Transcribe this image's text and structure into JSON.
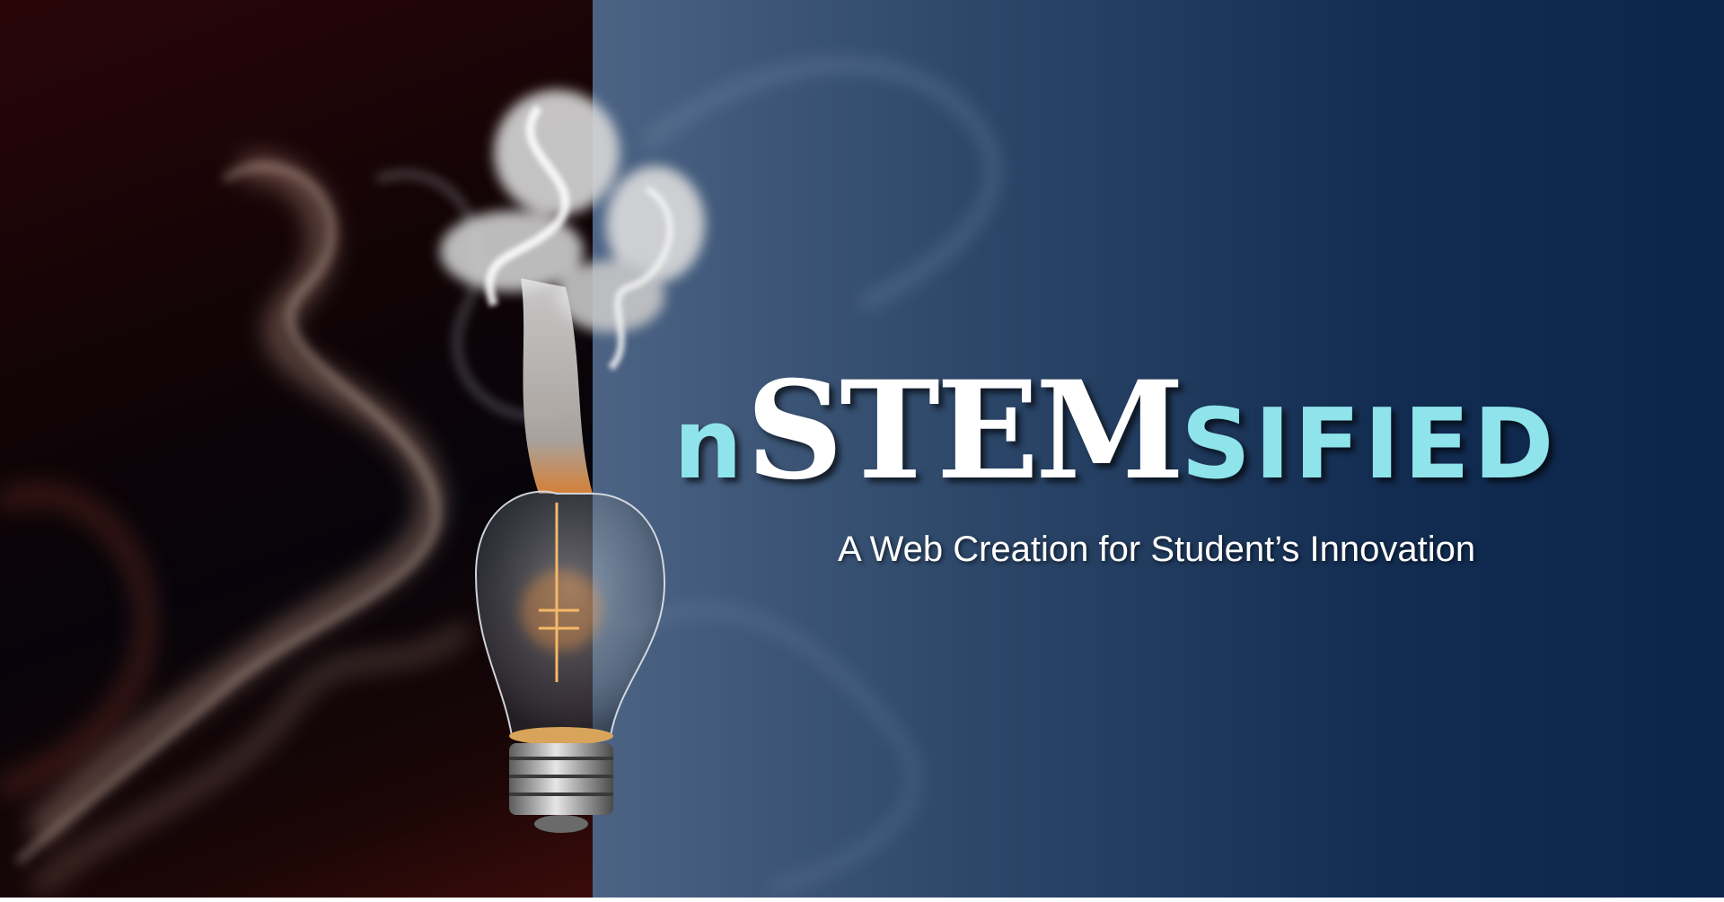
{
  "title": {
    "prefix": "n",
    "core": "STEM",
    "suffix": "sified"
  },
  "tagline": "A Web Creation for Student’s Innovation",
  "icons": {
    "bulb": "smoking-lightbulb-icon"
  },
  "colors": {
    "left_background": "#12040a",
    "left_red_glow": "#3a0c0a",
    "right_background": "#0b2449",
    "right_highlight": "#4c6384",
    "title_accent": "#8fe3ea",
    "title_main": "#ffffff",
    "tagline": "#ffffff"
  }
}
